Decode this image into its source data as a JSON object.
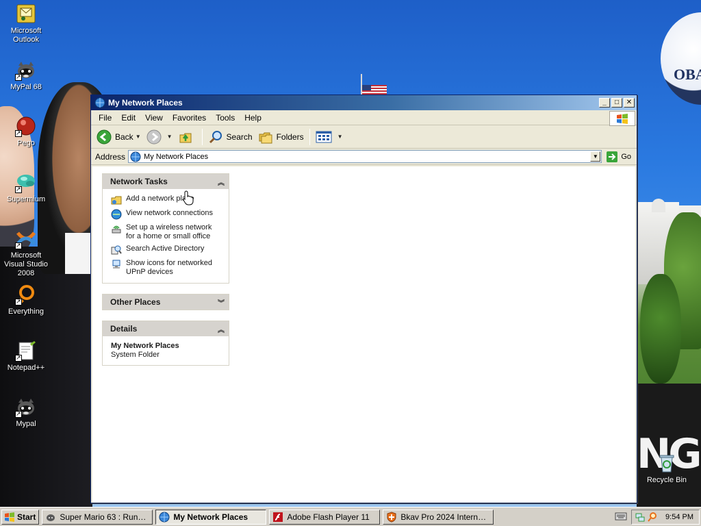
{
  "desktop": {
    "icons": [
      {
        "label": "Microsoft Outlook",
        "icon": "outlook-icon"
      },
      {
        "label": "MyPal 68",
        "icon": "mypal-icon"
      },
      {
        "label": "Pego",
        "icon": "pego-icon"
      },
      {
        "label": "Supermium",
        "icon": "supermium-icon"
      },
      {
        "label": "Microsoft Visual Studio 2008",
        "icon": "visual-studio-icon"
      },
      {
        "label": "Everything",
        "icon": "everything-icon"
      },
      {
        "label": "Notepad++",
        "icon": "notepadpp-icon"
      },
      {
        "label": "Mypal",
        "icon": "mypal-icon"
      },
      {
        "label": "Recycle Bin",
        "icon": "recycle-bin-icon"
      }
    ],
    "wallpaper_text": {
      "logo": "OBA",
      "slogan": "NG"
    }
  },
  "window": {
    "title": "My Network Places",
    "menu": [
      "File",
      "Edit",
      "View",
      "Favorites",
      "Tools",
      "Help"
    ],
    "toolbar": {
      "back": "Back",
      "search": "Search",
      "folders": "Folders"
    },
    "address": {
      "label": "Address",
      "value": "My Network Places",
      "go": "Go"
    },
    "panels": {
      "network_tasks": {
        "title": "Network Tasks",
        "items": [
          "Add a network place",
          "View network connections",
          "Set up a wireless network for a home or small office",
          "Search Active Directory",
          "Show icons for networked UPnP devices"
        ]
      },
      "other_places": {
        "title": "Other Places"
      },
      "details": {
        "title": "Details",
        "name": "My Network Places",
        "type": "System Folder"
      }
    }
  },
  "taskbar": {
    "start": "Start",
    "tasks": [
      {
        "label": "Super Mario 63 : Runou...",
        "active": false
      },
      {
        "label": "My Network Places",
        "active": true
      },
      {
        "label": "Adobe Flash Player 11",
        "active": false
      },
      {
        "label": "Bkav Pro 2024 Internet ...",
        "active": false
      }
    ],
    "clock": "9:54 PM"
  },
  "colors": {
    "title_bar_start": "#0a246a",
    "title_bar_end": "#a6caf0",
    "window_face": "#ece9d8",
    "panel_header": "#d6d3ce"
  }
}
